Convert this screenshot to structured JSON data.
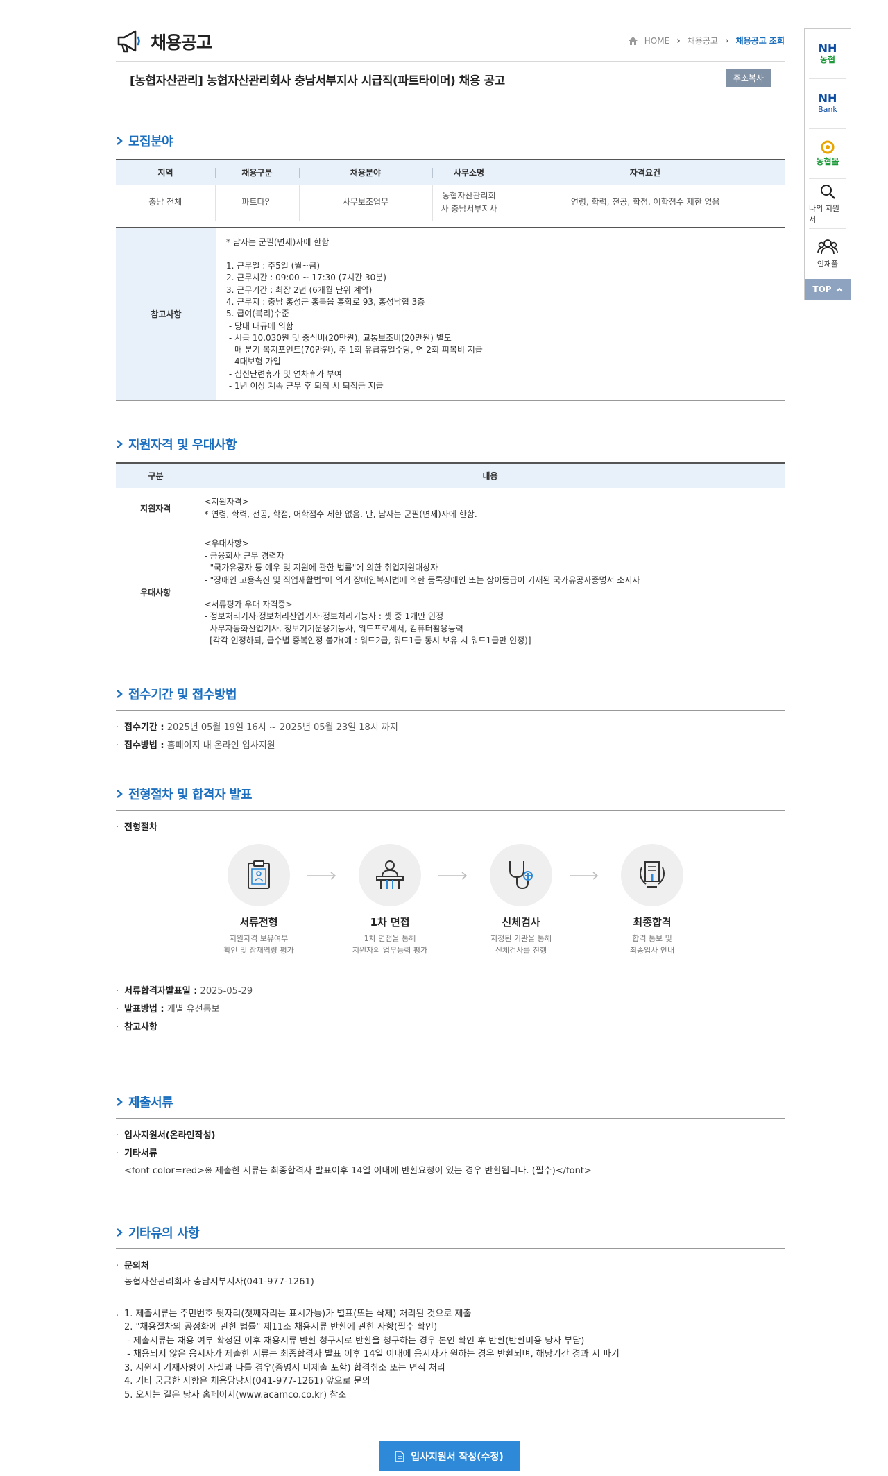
{
  "header": {
    "page_title": "채용공고",
    "breadcrumb": [
      "HOME",
      "채용공고",
      "채용공고 조회"
    ],
    "job_title": "[농협자산관리] 농협자산관리회사 충남서부지사 시급직(파트타이머) 채용 공고",
    "copy_button": "주소복사"
  },
  "recruit": {
    "title": "모집분야",
    "columns": [
      "지역",
      "채용구분",
      "채용분야",
      "사무소명",
      "자격요건"
    ],
    "row": [
      "충남 전체",
      "파트타임",
      "사무보조업무",
      "농협자산관리회\n사 충남서부지사",
      "연령, 학력, 전공, 학점, 어학점수 제한 없음"
    ],
    "ref_label": "참고사항",
    "ref_text": "* 남자는 군필(면제)자에 한함\n\n1. 근무일 : 주5일 (월~금)\n2. 근무시간 : 09:00 ~ 17:30 (7시간 30분)\n3. 근무기간 : 최장 2년 (6개월 단위 계약)\n4. 근무지 : 충남 홍성군 홍북읍 홍학로 93, 홍성낙협 3층\n5. 급여(복리)수준\n - 당내 내규에 의함\n - 시급 10,030원 및 중식비(20만원), 교통보조비(20만원) 별도\n - 매 분기 복지포인트(70만원), 주 1회 유급휴일수당, 연 2회 피복비 지급\n - 4대보험 가입\n - 심신단련휴가 및 연차휴가 부여\n - 1년 이상 계속 근무 후 퇴직 시 퇴직금 지급"
  },
  "qualify": {
    "title": "지원자격 및 우대사항",
    "columns": [
      "구분",
      "내용"
    ],
    "rows": [
      {
        "label": "지원자격",
        "text": "<지원자격>\n* 연령, 학력, 전공, 학점, 어학점수 제한 없음. 단, 남자는 군필(면제)자에 한함."
      },
      {
        "label": "우대사항",
        "text": "<우대사항>\n- 금융회사 근무 경력자\n- \"국가유공자 등 예우 및 지원에 관한 법률\"에 의한 취업지원대상자\n- \"장애인 고용촉진 및 직업재활법\"에 의거 장애인복지법에 의한 등록장애인 또는 상이등급이 기재된 국가유공자증명서 소지자\n\n<서류평가 우대 자격증>\n- 정보처리기사·정보처리산업기사·정보처리기능사 : 셋 중 1개만 인정\n- 사무자동화산업기사, 정보기기운용기능사, 워드프로세서, 컴퓨터활용능력\n  [각각 인정하되, 급수별 중복인정 불가(예 : 워드2급, 워드1급 동시 보유 시 워드1급만 인정)]"
      }
    ]
  },
  "receipt": {
    "title": "접수기간 및 접수방법",
    "period_label": "접수기간 :",
    "period_value": "2025년 05월 19일 16시 ~ 2025년 05월 23일 18시 까지",
    "method_label": "접수방법 :",
    "method_value": "홈페이지 내 온라인 입사지원"
  },
  "process": {
    "title": "전형절차 및 합격자 발표",
    "sub_label": "전형절차",
    "steps": [
      {
        "name": "서류전형",
        "desc": "지원자격 보유여부\n확인 및 잠재역량 평가"
      },
      {
        "name": "1차 면접",
        "desc": "1차 면접을 통해\n지원자의 업무능력 평가"
      },
      {
        "name": "신체검사",
        "desc": "지정된 기관을 통해\n신체검사를 진행"
      },
      {
        "name": "최종합격",
        "desc": "합격 통보 및\n최종입사 안내"
      }
    ],
    "announce_label": "서류합격자발표일 :",
    "announce_value": "2025-05-29",
    "notice_label": "발표방법 :",
    "notice_value": "개별 유선통보",
    "ref_label": "참고사항"
  },
  "documents": {
    "title": "제출서류",
    "item1": "입사지원서(온라인작성)",
    "item2": "기타서류",
    "note": "<font color=red>※ 제출한 서류는 최종합격자 발표이후 14일 이내에 반환요청이 있는 경우 반환됩니다. (필수)</font>"
  },
  "etc": {
    "title": "기타유의 사항",
    "contact_label": "문의처",
    "contact_value": "농협자산관리회사 충남서부지사(041-977-1261)",
    "notes": "1. 제출서류는 주민번호 뒷자리(첫째자리는 표시가능)가 별표(또는 삭제) 처리된 것으로 제출\n2. \"채용절차의 공정화에 관한 법률\" 제11조 채용서류 반환에 관한 사항(필수 확인)\n - 제출서류는 채용 여부 확정된 이후 채용서류 반환 청구서로 반환을 청구하는 경우 본인 확인 후 반환(반환비용 당사 부담)\n - 채용되지 않은 응시자가 제출한 서류는 최종합격자 발표 이후 14일 이내에 응시자가 원하는 경우 반환되며, 해당기간 경과 시 파기\n3. 지원서 기재사항이 사실과 다를 경우(증명서 미제출 포함) 합격취소 또는 면직 처리\n4. 기타 궁금한 사항은 채용담당자(041-977-1261) 앞으로 문의\n5. 오시는 길은 당사 홈페이지(www.acamco.co.kr) 참조"
  },
  "apply_button": "입사지원서 작성(수정)",
  "quickbar": {
    "nh_logo_top": "NH",
    "nh_logo_bottom": "농협",
    "bank_logo_top": "NH",
    "bank_logo_bottom": "Bank",
    "mall_label": "농협몰",
    "my_apply": "나의 지원서",
    "talent": "인재풀",
    "top": "TOP"
  },
  "colors": {
    "accent": "#1c6fbf",
    "button": "#2e8ad8",
    "table_head": "#e8f0fa"
  }
}
